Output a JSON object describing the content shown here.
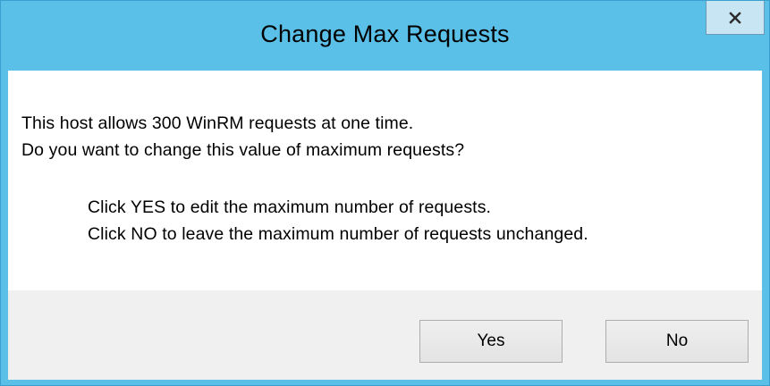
{
  "window": {
    "title": "Change Max Requests",
    "close_icon": "close-icon",
    "accent_color": "#5bc0e8"
  },
  "message": {
    "line1": "This host allows 300 WinRM requests at one time.",
    "line2": "Do you want to change this value of maximum requests?",
    "line3": "Click YES to edit the maximum number of requests.",
    "line4": "Click NO to leave the maximum number of requests unchanged."
  },
  "buttons": {
    "yes_label": "Yes",
    "no_label": "No"
  }
}
